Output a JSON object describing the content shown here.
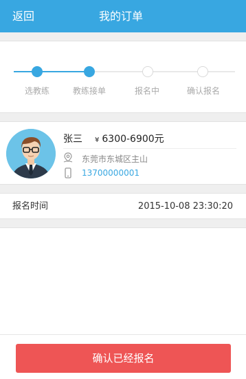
{
  "header": {
    "back_label": "返回",
    "title": "我的订单"
  },
  "progress": {
    "steps": [
      {
        "label": "选教练",
        "done": true
      },
      {
        "label": "教练接单",
        "done": true
      },
      {
        "label": "报名中",
        "done": false
      },
      {
        "label": "确认报名",
        "done": false
      }
    ],
    "accent_color": "#38a7e1"
  },
  "coach": {
    "name": "张三",
    "currency_symbol": "¥",
    "price": "6300-6900元",
    "address_icon": "location-pin-icon",
    "address": "东莞市东城区主山",
    "phone_icon": "mobile-phone-icon",
    "phone": "13700000001"
  },
  "signup_time": {
    "label": "报名时间",
    "value": "2015-10-08  23:30:20"
  },
  "footer": {
    "confirm_label": "确认已经报名",
    "button_color": "#ee5555"
  }
}
